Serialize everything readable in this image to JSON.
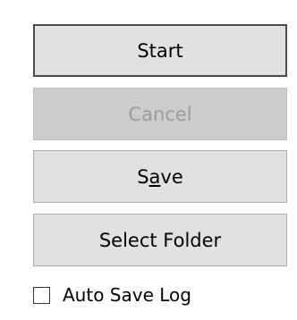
{
  "buttons": {
    "start": {
      "label": "Start"
    },
    "cancel": {
      "label": "Cancel"
    },
    "save": {
      "label_pre": "S",
      "label_mnemonic": "a",
      "label_post": "ve"
    },
    "select_folder": {
      "label": "Select Folder"
    }
  },
  "options": {
    "auto_save_log": {
      "label": "Auto Save Log",
      "checked": false
    }
  },
  "colors": {
    "button_face": "#e1e1e1",
    "button_border": "#adadad",
    "default_border": "#4a4a4a",
    "disabled_text": "#9a9a9a",
    "background": "#ffffff"
  }
}
